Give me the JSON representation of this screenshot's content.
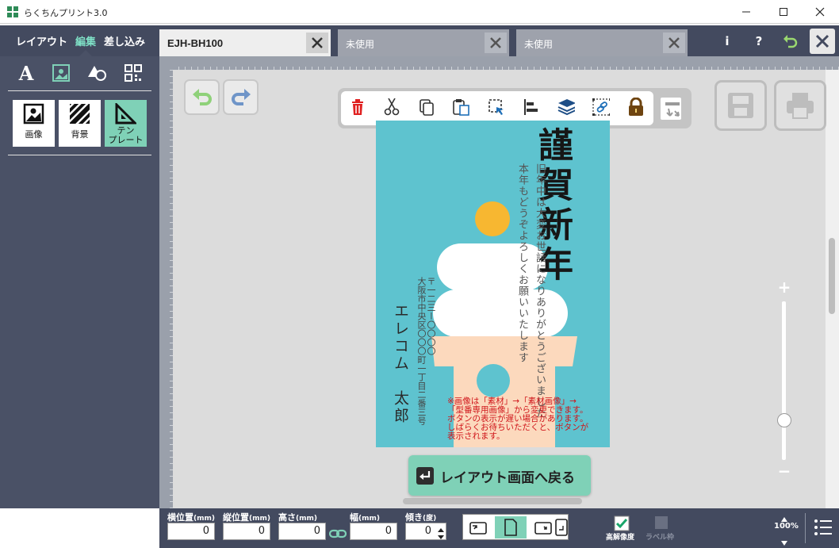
{
  "window": {
    "title": "らくちんプリント3.0",
    "minimize": "–",
    "maximize": "☐",
    "close": "✕"
  },
  "header": {
    "modes": [
      {
        "label": "レイアウト"
      },
      {
        "label": "編集"
      },
      {
        "label": "差し込み"
      }
    ],
    "doc_tabs": [
      {
        "label": "EJH-BH100"
      },
      {
        "label": "未使用"
      },
      {
        "label": "未使用"
      }
    ],
    "info": "i",
    "help": "?"
  },
  "left_panel": {
    "tools": [
      "text-icon",
      "image-icon",
      "shape-icon",
      "qr-code-icon"
    ],
    "categories": [
      {
        "label": "画像"
      },
      {
        "label": "背景"
      },
      {
        "label_line1": "テン",
        "label_line2": "プレート"
      }
    ]
  },
  "floating_toolbar": {
    "items": [
      "delete-icon",
      "cut-icon",
      "copy-icon",
      "paste-icon",
      "select-icon",
      "align-icon",
      "layers-icon",
      "group-icon",
      "lock-icon"
    ]
  },
  "card": {
    "greeting": "謹賀新年",
    "message_line1": "旧年中は大変お世話になりありがとうございました",
    "message_line2": "本年もどうぞよろしくお願いいたします",
    "postal": "〒一二三ー〇〇〇〇",
    "address": "大阪市中央区〇〇〇町一丁目二番三号",
    "sender": "エレコム　太郎",
    "note_lines": [
      "※画像は「素材」→「素材画像」→",
      "「型番専用画像」から変更できます。",
      "ボタンの表示が遅い場合があります。",
      "しばらくお待ちいただくと、ボタンが",
      "表示されます。"
    ],
    "colors": {
      "background": "#5ec3cf",
      "sun": "#f7b731",
      "mochi": "#ffffff",
      "base": "#fcd9bd"
    }
  },
  "back_button": {
    "label": "レイアウト画面へ戻る"
  },
  "zoom": {
    "plus": "+",
    "minus": "−",
    "level": 0.25,
    "label": "100%"
  },
  "bottom_bar": {
    "fields": [
      {
        "label": "横位置",
        "unit": "(mm)",
        "value": "0"
      },
      {
        "label": "縦位置",
        "unit": "(mm)",
        "value": "0"
      },
      {
        "label": "高さ",
        "unit": "(mm)",
        "value": "0"
      },
      {
        "label": "幅",
        "unit": "(mm)",
        "value": "0"
      },
      {
        "label": "傾き",
        "unit": "(度)",
        "value": "0"
      }
    ],
    "high_res": {
      "label": "高解像度",
      "checked": true
    },
    "label_frame": {
      "label": "ラベル枠",
      "checked": false
    }
  },
  "accent": "#7fd1b7",
  "dark": "#434a5f"
}
